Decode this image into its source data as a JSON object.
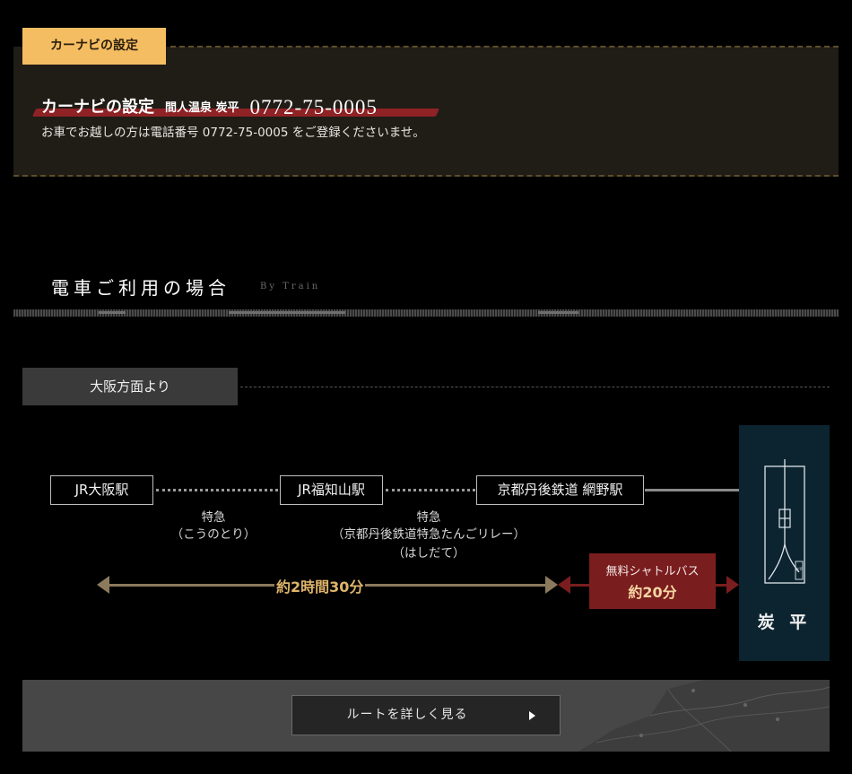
{
  "car_navi": {
    "tab_label": "カーナビの設定",
    "title_main": "カーナビの設定",
    "title_sub": "間人温泉 炭平",
    "phone": "0772-75-0005",
    "description": "お車でお越しの方は電話番号 0772-75-0005 をご登録くださいませ。"
  },
  "train_section": {
    "title": "電車ご利用の場合",
    "subtitle": "By Train"
  },
  "route": {
    "from_label": "大阪方面より",
    "stations": [
      "JR大阪駅",
      "JR福知山駅",
      "京都丹後鉄道 網野駅"
    ],
    "leg1": {
      "line1": "特急",
      "line2": "（こうのとり）"
    },
    "leg2": {
      "line1": "特急",
      "line2": "（京都丹後鉄道特急たんごリレー）",
      "line3": "（はしだて）"
    },
    "train_time": "約2時間30分",
    "shuttle_label": "無料シャトルバス",
    "shuttle_time": "約20分",
    "destination": "炭 平",
    "logo_seal": "炭平"
  },
  "map_button": {
    "label": "ルートを詳しく見る"
  },
  "colors": {
    "gold": "#f5bd62",
    "accent_red": "#8f2225",
    "shuttle_red": "#7a1d1e",
    "time_gold": "#e0b46a",
    "dest_navy": "#0c2430"
  }
}
